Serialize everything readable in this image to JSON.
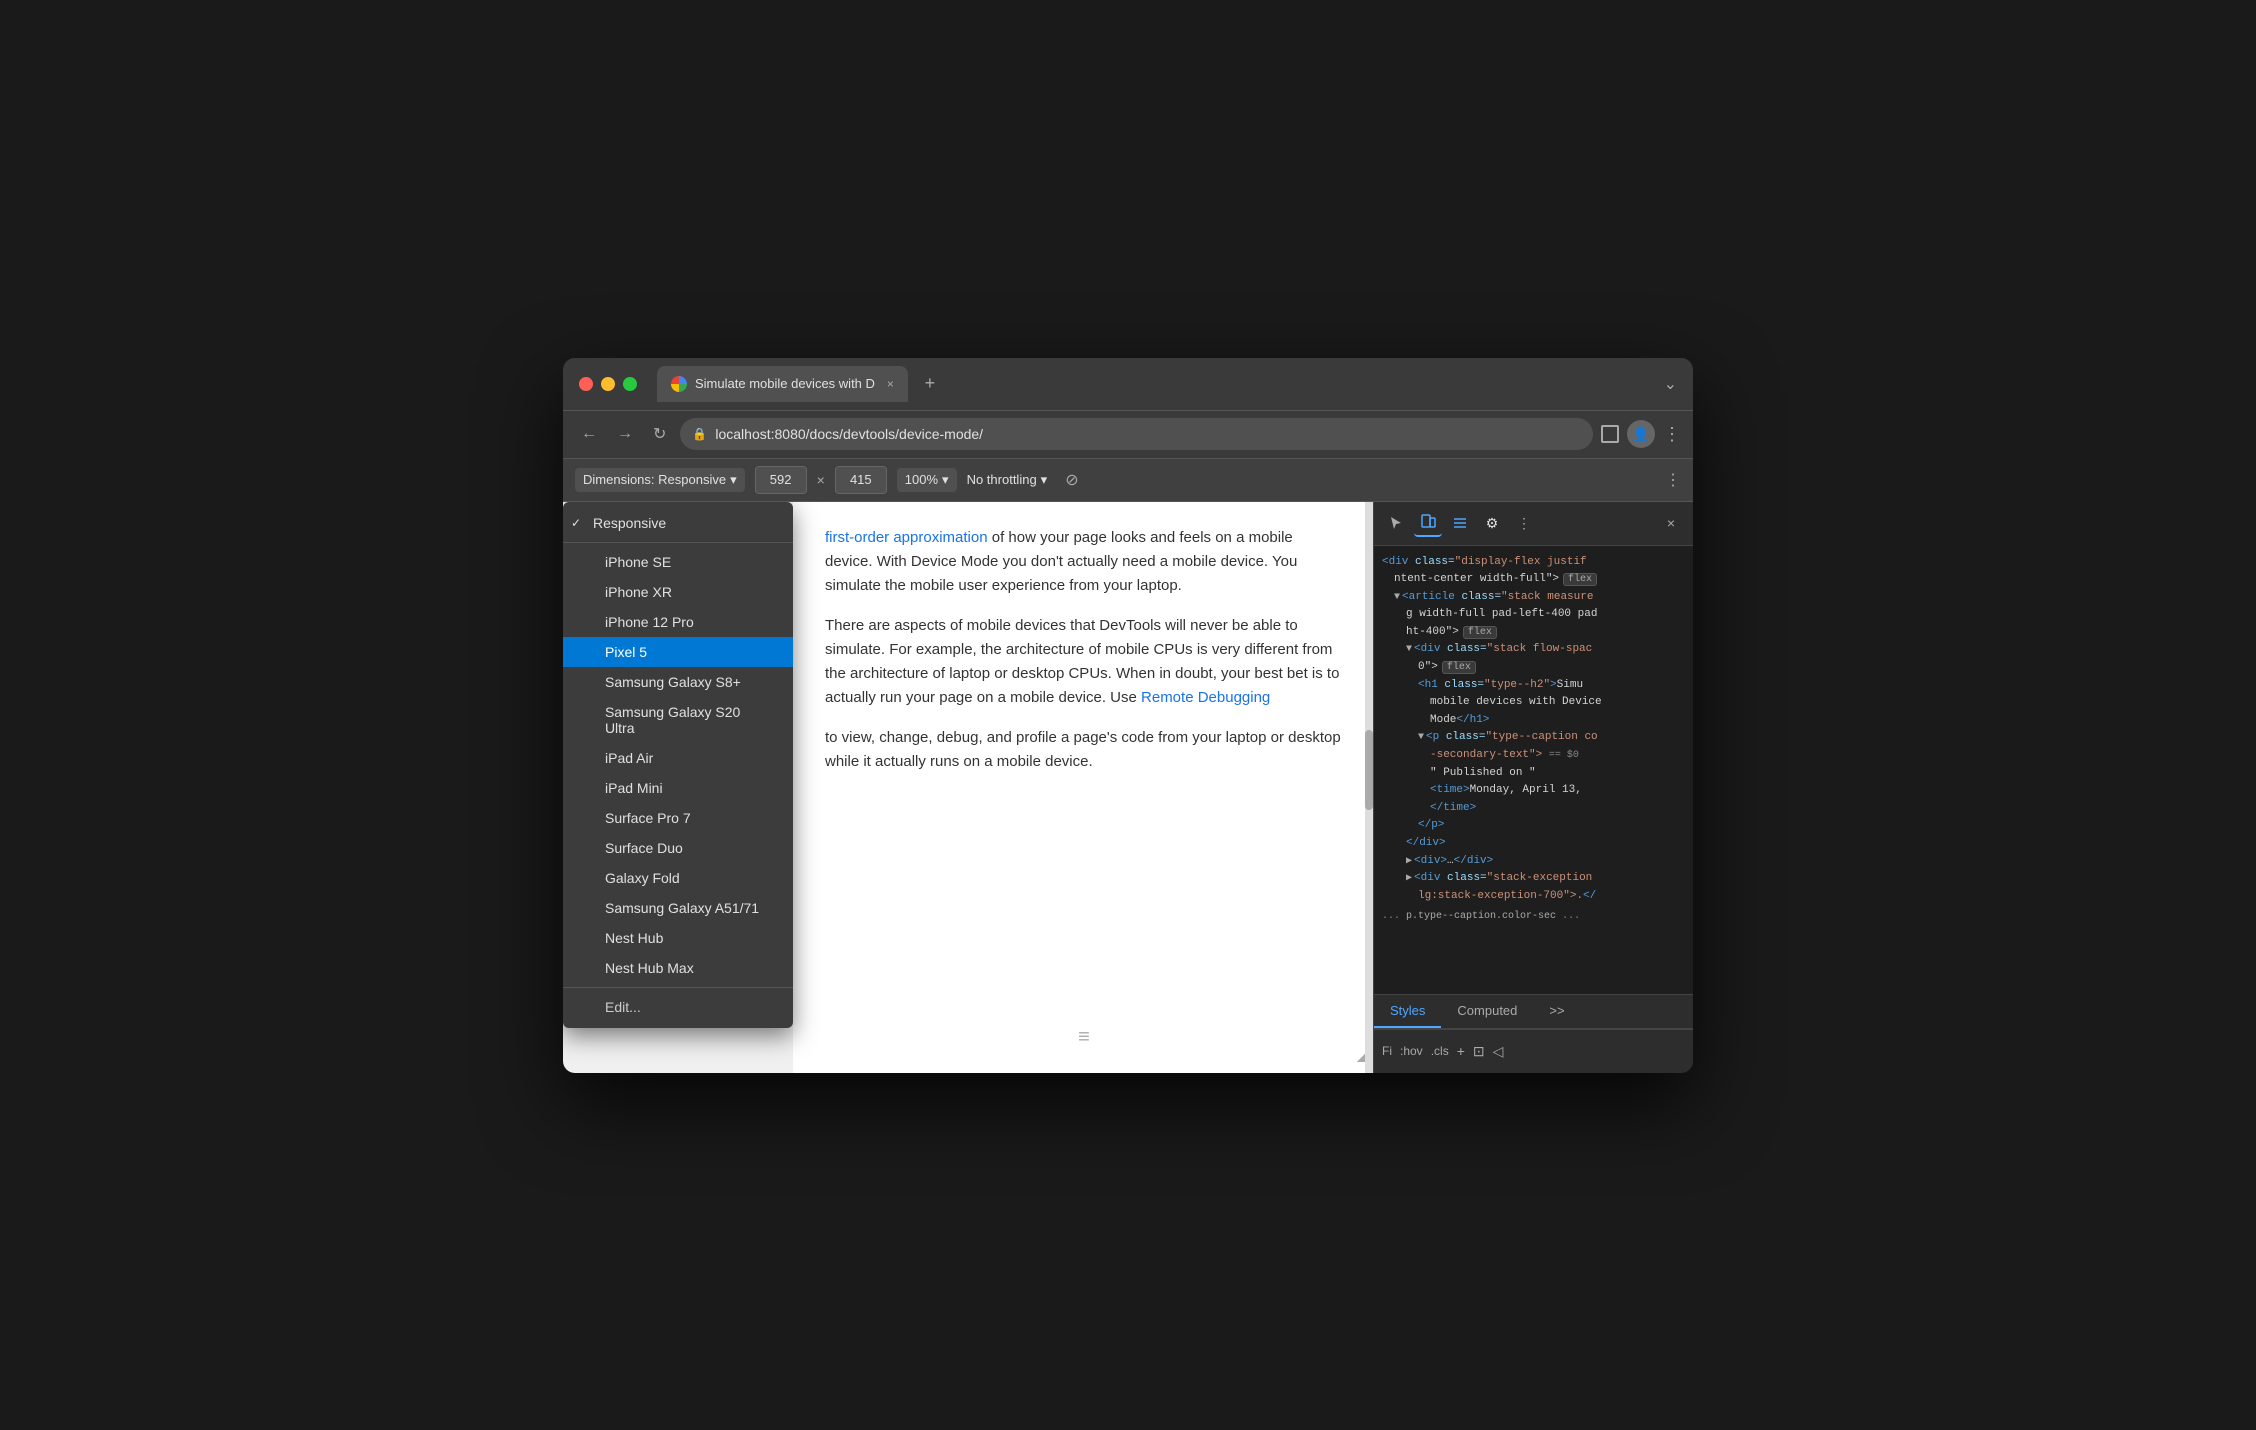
{
  "window": {
    "title": "Simulate mobile devices with D"
  },
  "titlebar": {
    "tab_title": "Simulate mobile devices with D",
    "tab_close": "×",
    "tab_new": "+",
    "more": "⌄"
  },
  "navbar": {
    "back": "←",
    "forward": "→",
    "reload": "↻",
    "url": "localhost:8080/docs/devtools/device-mode/",
    "menu": "⋮",
    "profile": "Guest"
  },
  "device_toolbar": {
    "dimensions_label": "Dimensions: Responsive",
    "width": "592",
    "height": "415",
    "zoom": "100%",
    "throttling": "No throttling",
    "dropdown_arrow": "▾"
  },
  "dropdown": {
    "items": [
      {
        "id": "responsive",
        "label": "Responsive",
        "checked": true,
        "selected": false
      },
      {
        "id": "iphone-se",
        "label": "iPhone SE",
        "checked": false,
        "selected": false
      },
      {
        "id": "iphone-xr",
        "label": "iPhone XR",
        "checked": false,
        "selected": false
      },
      {
        "id": "iphone-12-pro",
        "label": "iPhone 12 Pro",
        "checked": false,
        "selected": false
      },
      {
        "id": "pixel-5",
        "label": "Pixel 5",
        "checked": false,
        "selected": true
      },
      {
        "id": "samsung-s8plus",
        "label": "Samsung Galaxy S8+",
        "checked": false,
        "selected": false
      },
      {
        "id": "samsung-s20-ultra",
        "label": "Samsung Galaxy S20 Ultra",
        "checked": false,
        "selected": false
      },
      {
        "id": "ipad-air",
        "label": "iPad Air",
        "checked": false,
        "selected": false
      },
      {
        "id": "ipad-mini",
        "label": "iPad Mini",
        "checked": false,
        "selected": false
      },
      {
        "id": "surface-pro-7",
        "label": "Surface Pro 7",
        "checked": false,
        "selected": false
      },
      {
        "id": "surface-duo",
        "label": "Surface Duo",
        "checked": false,
        "selected": false
      },
      {
        "id": "galaxy-fold",
        "label": "Galaxy Fold",
        "checked": false,
        "selected": false
      },
      {
        "id": "samsung-a51",
        "label": "Samsung Galaxy A51/71",
        "checked": false,
        "selected": false
      },
      {
        "id": "nest-hub",
        "label": "Nest Hub",
        "checked": false,
        "selected": false
      },
      {
        "id": "nest-hub-max",
        "label": "Nest Hub Max",
        "checked": false,
        "selected": false
      },
      {
        "id": "edit",
        "label": "Edit...",
        "checked": false,
        "selected": false,
        "isEdit": true
      }
    ]
  },
  "page_content": {
    "para1_link": "first-order approximation",
    "para1_rest": " of how your page looks and feels on a mobile device. With Device Mode you don't actually need a mobile device. You simulate the mobile user experience from your laptop.",
    "para2_prefix": "There are aspects of mobile devices that DevTools will never be able to simulate. For example, the architecture of mobile CPUs is very different from the architecture of laptop or desktop CPUs. When in doubt, your best bet is to actually run your page on a mobile device. Use ",
    "para2_link": "Remote Debugging",
    "para2_suffix": "",
    "para3": "to view, change, debug, and profile a page's code from your laptop or desktop while it actually runs on a mobile device."
  },
  "devtools": {
    "toolbar": {
      "icons": [
        "⬚",
        "▭",
        "≡",
        "⚙",
        "⋮",
        "×"
      ]
    },
    "code_lines": [
      "<div class=\"display-flex justif",
      "ntent-center width-full\">",
      "<article class=\"stack measure",
      "g width-full pad-left-400 pad",
      "ht-400\">",
      "<div class=\"stack flow-spac",
      "0\">",
      "<h1 class=\"type--h2\">Simu",
      "mobile devices with Device",
      "Mode</h1>",
      "<p class=\"type--caption co",
      "-secondary-text\"> == $0",
      "\" Published on \"",
      "<time>Monday, April 13,",
      "</time>",
      "</p>",
      "</div>",
      "<div>…</div>",
      "<div class=\"stack-exception",
      "lg:stack-exception-700\">.</",
      "... p.type--caption.color-sec ..."
    ],
    "tabs": {
      "styles": "Styles",
      "computed": "Computed",
      "more": ">>"
    },
    "footer": {
      "filter": "Fi",
      "hov": ":hov",
      "cls": ".cls",
      "plus": "+",
      "icon1": "⊡",
      "icon2": "◁"
    }
  }
}
